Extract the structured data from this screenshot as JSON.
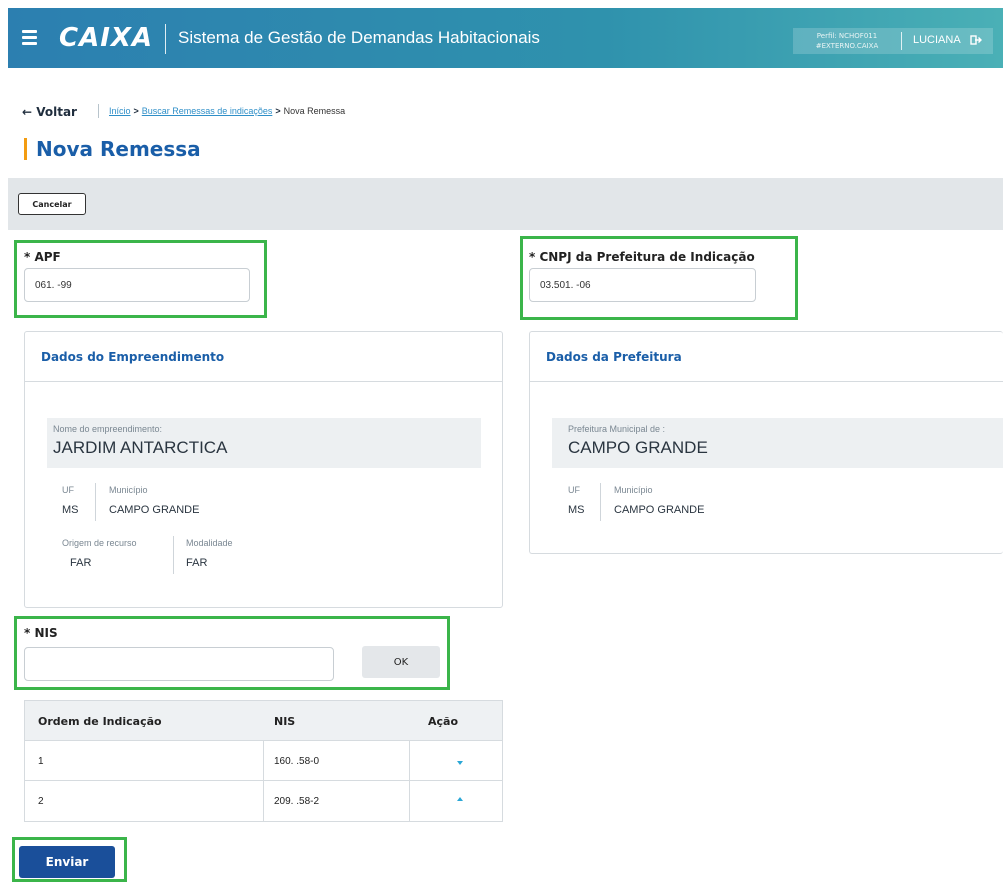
{
  "header": {
    "logo_text": "CAIXA",
    "app_title": "Sistema de Gestão de Demandas Habitacionais",
    "perfil_line1": "Perfil: NCHOF011",
    "perfil_line2": "#EXTERNO.CAIXA",
    "user_name": "LUCIANA",
    "menu_icon": "hamburger-icon",
    "logout_icon": "logout-icon"
  },
  "nav": {
    "back_label": "← Voltar",
    "breadcrumb": [
      "Início",
      "Buscar Remessas de indicações",
      "Nova Remessa"
    ],
    "separator": ">"
  },
  "page": {
    "title": "Nova Remessa",
    "cancel_label": "Cancelar"
  },
  "form": {
    "apf_label": "* APF",
    "apf_value": "061.      -99",
    "cnpj_label": "* CNPJ da Prefeitura de Indicação",
    "cnpj_value": "03.501.              -06",
    "nis_label": "* NIS",
    "nis_value": "",
    "ok_label": "OK"
  },
  "empreendimento": {
    "title": "Dados do Empreendimento",
    "name_label": "Nome do empreendimento:",
    "name_value": "JARDIM ANTARCTICA",
    "uf_label": "UF",
    "uf_value": "MS",
    "municipio_label": "Município",
    "municipio_value": "CAMPO GRANDE",
    "origem_label": "Origem de recurso",
    "origem_value": "FAR",
    "modalidade_label": "Modalidade",
    "modalidade_value": "FAR"
  },
  "prefeitura": {
    "title": "Dados da Prefeitura",
    "name_label": "Prefeitura Municipal de :",
    "name_value": "CAMPO GRANDE",
    "uf_label": "UF",
    "uf_value": "MS",
    "municipio_label": "Município",
    "municipio_value": "CAMPO GRANDE"
  },
  "table": {
    "headers": [
      "Ordem de Indicação",
      "NIS",
      "Ação"
    ],
    "rows": [
      {
        "ordem": "1",
        "nis": "160.        .58-0",
        "action_icon": "move-down-icon"
      },
      {
        "ordem": "2",
        "nis": "209.        .58-2",
        "action_icon": "move-up-icon"
      }
    ]
  },
  "footer": {
    "send_label": "Enviar"
  },
  "colors": {
    "accent_blue": "#1a5ea8",
    "highlight_green": "#3bb54a",
    "title_accent": "#f39c12",
    "action_icon": "#2aa7d6"
  }
}
